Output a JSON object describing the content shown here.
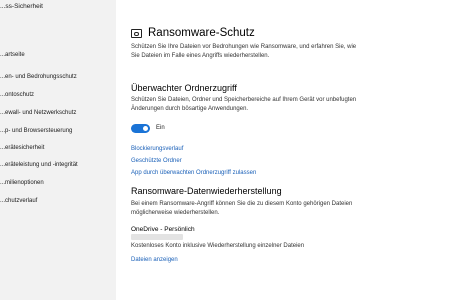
{
  "window": {
    "title": "...ss-Sicherheit"
  },
  "sidebar": {
    "items": [
      {
        "label": "...artseite"
      },
      {
        "label": "...en- und Bedrohungsschutz"
      },
      {
        "label": "...ontoschutz"
      },
      {
        "label": "...ewall- und Netzwerkschutz"
      },
      {
        "label": "...p- und Browsersteuerung"
      },
      {
        "label": "...erätesicherheit"
      },
      {
        "label": "...eräteleistung und -integrität"
      },
      {
        "label": "...milienoptionen"
      },
      {
        "label": "...chutzverlauf"
      }
    ]
  },
  "main": {
    "title": "Ransomware-Schutz",
    "intro": "Schützen Sie Ihre Dateien vor Bedrohungen wie Ransomware, und erfahren Sie, wie Sie Dateien im Falle eines Angriffs wiederherstellen.",
    "folder_access": {
      "heading": "Überwachter Ordnerzugriff",
      "description": "Schützen Sie Dateien, Ordner und Speicherbereiche auf Ihrem Gerät vor unbefugten Änderungen durch bösartige Anwendungen.",
      "toggle_state": "on",
      "toggle_label": "Ein",
      "links": [
        "Blockierungsverlauf",
        "Geschützte Ordner",
        "App durch überwachten Ordnerzugriff zulassen"
      ]
    },
    "recovery": {
      "heading": "Ransomware-Datenwiederherstellung",
      "description": "Bei einem Ransomware-Angriff können Sie die zu diesem Konto gehörigen Dateien möglicherweise wiederherstellen.",
      "onedrive_title": "OneDrive - Persönlich",
      "onedrive_desc": "Kostenloses Konto inklusive Wiederherstellung einzelner Dateien",
      "show_files_link": "Dateien anzeigen"
    }
  },
  "colors": {
    "accent": "#1a73d6",
    "link": "#1a60b8",
    "sidebar_bg": "#f2f2f2"
  }
}
